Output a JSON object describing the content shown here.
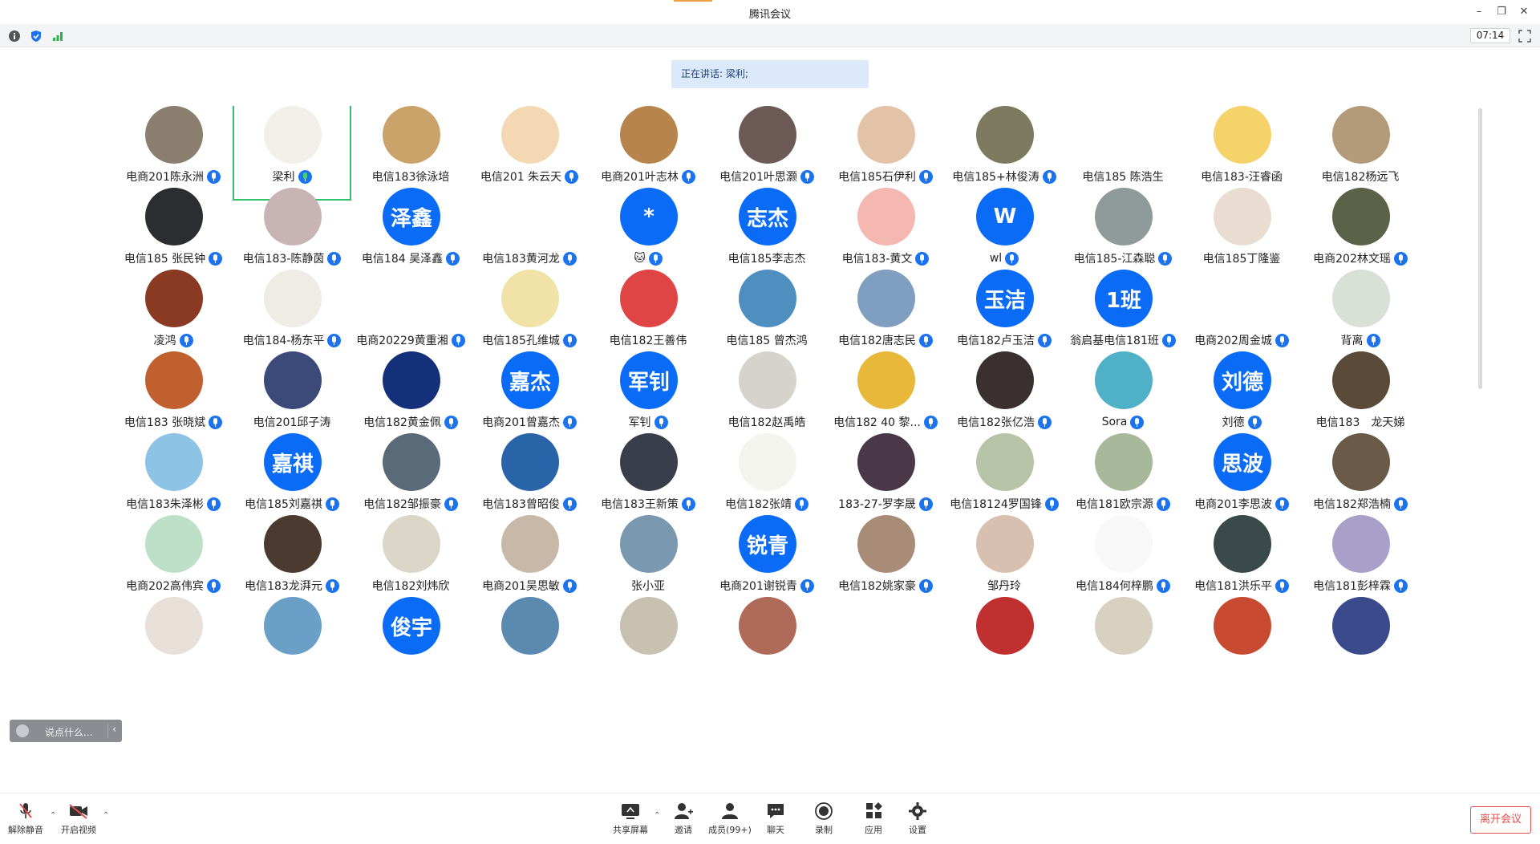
{
  "window": {
    "title": "腾讯会议",
    "minimize_icon": "minimize-icon",
    "restore_icon": "restore-icon",
    "close_icon": "close-icon"
  },
  "infobar": {
    "timer": "07:14"
  },
  "speaker": {
    "prefix": "正在讲话:",
    "name": "梁利;"
  },
  "participants": [
    [
      {
        "name": "电商201陈永洲",
        "avatar": "img",
        "bg": "#8a7f6e"
      },
      {
        "name": "梁利",
        "avatar": "img",
        "bg": "#f2efe8",
        "active": true
      },
      {
        "name": "电信183徐泳培",
        "avatar": "img",
        "bg": "#c9a36a",
        "nomic": true
      },
      {
        "name": "电信201 朱云天",
        "avatar": "img",
        "bg": "#f4d8b4"
      },
      {
        "name": "电商201叶志林",
        "avatar": "img",
        "bg": "#b7854b"
      },
      {
        "name": "电信201叶思灏",
        "avatar": "img",
        "bg": "#6b5a55"
      },
      {
        "name": "电信185石伊利",
        "avatar": "img",
        "bg": "#e3c3a8"
      },
      {
        "name": "电信185+林俊涛",
        "avatar": "img",
        "bg": "#7d7a5f"
      },
      {
        "name": "电信185 陈浩生",
        "avatar": "img",
        "bg": "#ffffff",
        "nomic": true
      },
      {
        "name": "电信183-汪睿函",
        "avatar": "img",
        "bg": "#f5d36a",
        "nomic": true
      },
      {
        "name": "电信182杨远飞",
        "avatar": "img",
        "bg": "#b39a78",
        "nomic": true
      }
    ],
    [
      {
        "name": "电信185 张民钟",
        "avatar": "img",
        "bg": "#2b2d30"
      },
      {
        "name": "电信183-陈静茵",
        "avatar": "img",
        "bg": "#c8b3b5"
      },
      {
        "name": "电信184 吴泽鑫",
        "avatar": "text",
        "text": "泽鑫"
      },
      {
        "name": "电信183黄河龙",
        "avatar": "none"
      },
      {
        "name": "🐱",
        "avatar": "text",
        "text": "*"
      },
      {
        "name": "电信185李志杰",
        "avatar": "text",
        "text": "志杰",
        "nomic": true
      },
      {
        "name": "电信183-黄文",
        "avatar": "img",
        "bg": "#f4b8b0"
      },
      {
        "name": "wl",
        "avatar": "text",
        "text": "W"
      },
      {
        "name": "电信185-江森聪",
        "avatar": "img",
        "bg": "#8f9a9a"
      },
      {
        "name": "电信185丁隆鉴",
        "avatar": "img",
        "bg": "#e8ddd0",
        "nomic": true
      },
      {
        "name": "电商202林文瑶",
        "avatar": "img",
        "bg": "#5a6248"
      }
    ],
    [
      {
        "name": "凌鸿",
        "avatar": "img",
        "bg": "#8a3a22"
      },
      {
        "name": "电信184-杨东平",
        "avatar": "img",
        "bg": "#efece6"
      },
      {
        "name": "电商20229黄重湘",
        "avatar": "img",
        "bg": "#ffffff"
      },
      {
        "name": "电信185孔维城",
        "avatar": "img",
        "bg": "#f1e3a8"
      },
      {
        "name": "电信182王善伟",
        "avatar": "img",
        "bg": "#e04545",
        "nomic": true
      },
      {
        "name": "电信185 曾杰鸿",
        "avatar": "img",
        "bg": "#4f8fc0",
        "nomic": true
      },
      {
        "name": "电信182唐志民",
        "avatar": "img",
        "bg": "#7f9ec0"
      },
      {
        "name": "电信182卢玉洁",
        "avatar": "text",
        "text": "玉洁"
      },
      {
        "name": "翁启基电信181班",
        "avatar": "text",
        "text": "1班"
      },
      {
        "name": "电商202周金城",
        "avatar": "img",
        "bg": "#ffffff"
      },
      {
        "name": "背离",
        "avatar": "img",
        "bg": "#d9e0d6"
      }
    ],
    [
      {
        "name": "电信183 张晓斌",
        "avatar": "img",
        "bg": "#c0602e"
      },
      {
        "name": "电信201邱子涛",
        "avatar": "img",
        "bg": "#3c4a7a",
        "nomic": true
      },
      {
        "name": "电信182黄金佩",
        "avatar": "img",
        "bg": "#15307a"
      },
      {
        "name": "电商201曾嘉杰",
        "avatar": "text",
        "text": "嘉杰"
      },
      {
        "name": "军钊",
        "avatar": "text",
        "text": "军钊"
      },
      {
        "name": "电信182赵禹皓",
        "avatar": "img",
        "bg": "#d6d3cc",
        "nomic": true
      },
      {
        "name": "电信182 40 黎...",
        "avatar": "img",
        "bg": "#e8b83a"
      },
      {
        "name": "电信182张亿浩",
        "avatar": "img",
        "bg": "#3a3030"
      },
      {
        "name": "Sora",
        "avatar": "img",
        "bg": "#4fb0c8"
      },
      {
        "name": "刘德",
        "avatar": "text",
        "text": "刘德"
      },
      {
        "name": "电信183　龙天娣",
        "avatar": "img",
        "bg": "#5a4a38",
        "nomic": true
      }
    ],
    [
      {
        "name": "电信183朱泽彬",
        "avatar": "img",
        "bg": "#8dc4e6"
      },
      {
        "name": "电信185刘嘉祺",
        "avatar": "text",
        "text": "嘉祺"
      },
      {
        "name": "电信182邹振豪",
        "avatar": "img",
        "bg": "#5a6a78"
      },
      {
        "name": "电信183曾昭俊",
        "avatar": "img",
        "bg": "#2a64a8"
      },
      {
        "name": "电信183王新策",
        "avatar": "img",
        "bg": "#3a3e4a"
      },
      {
        "name": "电信182张靖",
        "avatar": "img",
        "bg": "#f4f4ee"
      },
      {
        "name": "183-27-罗李晟",
        "avatar": "img",
        "bg": "#4a3848"
      },
      {
        "name": "电信18124罗国锋",
        "avatar": "img",
        "bg": "#b8c4a8"
      },
      {
        "name": "电信181欧宗源",
        "avatar": "img",
        "bg": "#a8b89a"
      },
      {
        "name": "电商201李思波",
        "avatar": "text",
        "text": "思波"
      },
      {
        "name": "电信182郑浩楠",
        "avatar": "img",
        "bg": "#6a5a48"
      }
    ],
    [
      {
        "name": "电商202高伟宾",
        "avatar": "img",
        "bg": "#bfe0c8"
      },
      {
        "name": "电信183龙湃元",
        "avatar": "img",
        "bg": "#4a3a30"
      },
      {
        "name": "电信182刘炜欣",
        "avatar": "img",
        "bg": "#dcd6c8",
        "nomic": true
      },
      {
        "name": "电商201吴思敏",
        "avatar": "img",
        "bg": "#c8b8a8"
      },
      {
        "name": "张小亚",
        "avatar": "img",
        "bg": "#7a98b0",
        "nomic": true
      },
      {
        "name": "电商201谢锐青",
        "avatar": "text",
        "text": "锐青"
      },
      {
        "name": "电信182姚家豪",
        "avatar": "img",
        "bg": "#a88c78"
      },
      {
        "name": "邹丹玲",
        "avatar": "img",
        "bg": "#d8c0b0",
        "nomic": true
      },
      {
        "name": "电信184何梓鹏",
        "avatar": "img",
        "bg": "#f8f8f8"
      },
      {
        "name": "电信181洪乐平",
        "avatar": "img",
        "bg": "#3a4a4a"
      },
      {
        "name": "电信181彭梓霖",
        "avatar": "img",
        "bg": "#a8a0c8"
      }
    ],
    [
      {
        "name": "",
        "avatar": "img",
        "bg": "#e8e0d8"
      },
      {
        "name": "",
        "avatar": "img",
        "bg": "#6aa0c8"
      },
      {
        "name": "",
        "avatar": "text",
        "text": "俊宇"
      },
      {
        "name": "",
        "avatar": "img",
        "bg": "#5a8ab0"
      },
      {
        "name": "",
        "avatar": "img",
        "bg": "#c8c0b0"
      },
      {
        "name": "",
        "avatar": "img",
        "bg": "#b06a5a"
      },
      {
        "name": "",
        "avatar": "img",
        "bg": "#ffffff"
      },
      {
        "name": "",
        "avatar": "img",
        "bg": "#c03030"
      },
      {
        "name": "",
        "avatar": "img",
        "bg": "#d8d0c0"
      },
      {
        "name": "",
        "avatar": "img",
        "bg": "#c84a30"
      },
      {
        "name": "",
        "avatar": "img",
        "bg": "#3a4a8a"
      }
    ]
  ],
  "chat": {
    "placeholder": "说点什么..."
  },
  "toolbar": {
    "unmute": "解除静音",
    "start_video": "开启视频",
    "share_screen": "共享屏幕",
    "invite": "邀请",
    "members": "成员(99+)",
    "chat": "聊天",
    "record": "录制",
    "apps": "应用",
    "settings": "设置",
    "leave": "离开会议"
  }
}
